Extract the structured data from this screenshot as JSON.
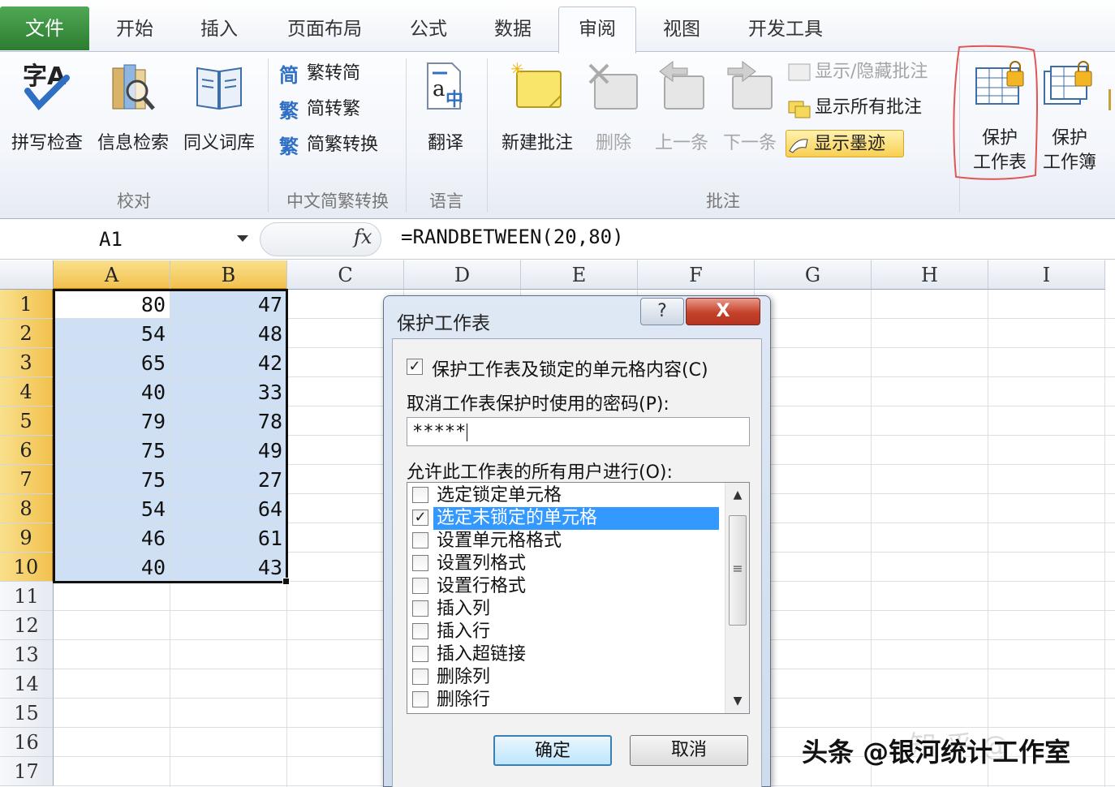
{
  "tabs": {
    "file": "文件",
    "home": "开始",
    "insert": "插入",
    "page_layout": "页面布局",
    "formulas": "公式",
    "data": "数据",
    "review": "审阅",
    "view": "视图",
    "developer": "开发工具"
  },
  "ribbon": {
    "proofing": {
      "spelling": "拼写检查",
      "research": "信息检索",
      "thesaurus": "同义词库",
      "group_label": "校对"
    },
    "chinese_conversion": {
      "to_simplified": "繁转简",
      "to_traditional": "简转繁",
      "convert": "简繁转换",
      "group_label": "中文简繁转换"
    },
    "language": {
      "translate": "翻译",
      "group_label": "语言"
    },
    "comments": {
      "new": "新建批注",
      "delete": "删除",
      "previous": "上一条",
      "next": "下一条",
      "show_hide": "显示/隐藏批注",
      "show_all": "显示所有批注",
      "show_ink": "显示墨迹",
      "group_label": "批注"
    },
    "changes": {
      "protect_sheet_1": "保护",
      "protect_sheet_2": "工作表",
      "protect_workbook_1": "保护",
      "protect_workbook_2": "工作簿"
    }
  },
  "formula_bar": {
    "name_box": "A1",
    "fx": "fx",
    "formula": "=RANDBETWEEN(20,80)"
  },
  "sheet": {
    "columns": [
      "A",
      "B",
      "C",
      "D",
      "E",
      "F",
      "G",
      "H",
      "I"
    ],
    "rows": [
      "1",
      "2",
      "3",
      "4",
      "5",
      "6",
      "7",
      "8",
      "9",
      "10",
      "11",
      "12",
      "13",
      "14",
      "15",
      "16",
      "17"
    ],
    "col_a": [
      "80",
      "54",
      "65",
      "40",
      "79",
      "75",
      "75",
      "54",
      "46",
      "40"
    ],
    "col_b": [
      "47",
      "48",
      "42",
      "33",
      "78",
      "49",
      "27",
      "64",
      "61",
      "43"
    ]
  },
  "dialog": {
    "title": "保护工作表",
    "help": "?",
    "close": "X",
    "protect_checkbox_label": "保护工作表及锁定的单元格内容(C)",
    "password_label": "取消工作表保护时使用的密码(P):",
    "password_value": "*****",
    "allow_label": "允许此工作表的所有用户进行(O):",
    "options": [
      {
        "label": "选定锁定单元格",
        "checked": false
      },
      {
        "label": "选定未锁定的单元格",
        "checked": true
      },
      {
        "label": "设置单元格格式",
        "checked": false
      },
      {
        "label": "设置列格式",
        "checked": false
      },
      {
        "label": "设置行格式",
        "checked": false
      },
      {
        "label": "插入列",
        "checked": false
      },
      {
        "label": "插入行",
        "checked": false
      },
      {
        "label": "插入超链接",
        "checked": false
      },
      {
        "label": "删除列",
        "checked": false
      },
      {
        "label": "删除行",
        "checked": false
      }
    ],
    "ok": "确定",
    "cancel": "取消"
  },
  "watermark": "头条 @银河统计工作室",
  "colors": {
    "file_tab": "#2c7c31",
    "selection": "#cfe0f4",
    "header_selected": "#f2c14e",
    "list_highlight": "#3399ff",
    "close_button": "#c4402a",
    "annotation_circle": "#e05555"
  }
}
